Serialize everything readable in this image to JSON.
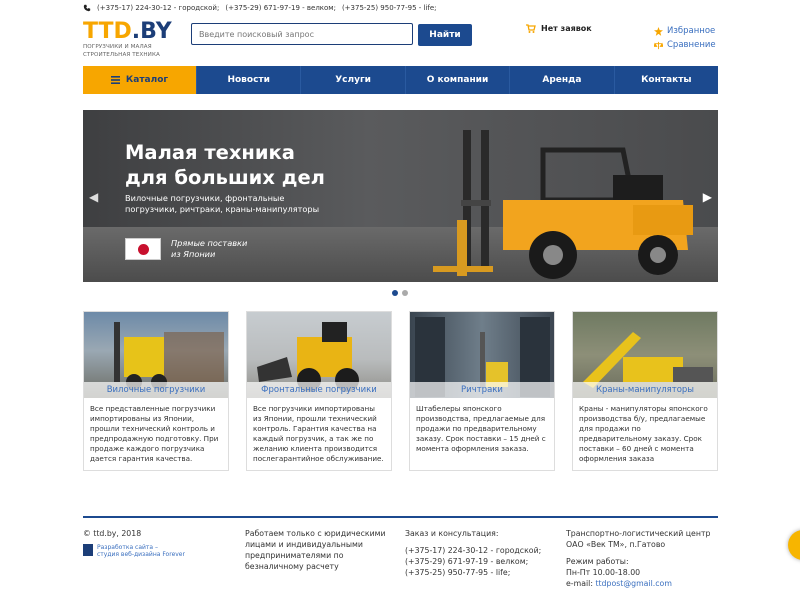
{
  "topbar": {
    "phone1": "(+375-17) 224-30-12 - городской;",
    "phone2": "(+375-29) 671-97-19 - велком;",
    "phone3": "(+375-25) 950-77-95 - life;"
  },
  "logo": {
    "main_a": "TTD",
    "main_b": ".BY",
    "sub1": "Погрузчики и малая",
    "sub2": "строительная техника"
  },
  "search": {
    "placeholder": "Введите поисковый запрос",
    "button": "Найти"
  },
  "cart": {
    "label": "Нет заявок"
  },
  "favs": {
    "favorites": "Избранное",
    "compare": "Сравнение"
  },
  "nav": {
    "catalog": "Каталог",
    "items": [
      "Новости",
      "Услуги",
      "О компании",
      "Аренда",
      "Контакты"
    ]
  },
  "hero": {
    "title1": "Малая техника",
    "title2": "для больших дел",
    "sub1": "Вилочные погрузчики, фронтальные",
    "sub2": "погрузчики, ричтраки, краны-манипуляторы",
    "direct1": "Прямые поставки",
    "direct2": "из Японии"
  },
  "cards": [
    {
      "title": "Вилочные погрузчики",
      "text": "Все представленные погрузчики импортированы из Японии, прошли технический контроль и предпродажную подготовку. При продаже каждого погрузчика дается гарантия качества."
    },
    {
      "title": "Фронтальные погрузчики",
      "text": "Все погрузчики импортированы из Японии, прошли технический контроль. Гарантия качества на каждый погрузчик, а так же по желанию клиента производится послегарантийное обслуживание."
    },
    {
      "title": "Ричтраки",
      "text": "Штабелеры японского производства, предлагаемые для продажи по предварительному заказу. Срок поставки – 15 дней с момента оформления заказа."
    },
    {
      "title": "Краны-манипуляторы",
      "text": "Краны - манипуляторы японского производства б/у, предлагаемые для продажи по предварительному заказу. Срок поставки – 60 дней с момента оформления заказа"
    }
  ],
  "footer": {
    "copyright": "© ttd.by, 2018",
    "dev1": "Разработка сайта –",
    "dev2": "студия веб-дизайна Forever",
    "legal": "Работаем только с юридическими лицами и индивидуальными предпринимателями по безналичному расчету",
    "order_title": "Заказ и консультация:",
    "order_p1": "(+375-17) 224-30-12 - городской;",
    "order_p2": "(+375-29) 671-97-19 - велком;",
    "order_p3": "(+375-25) 950-77-95 - life;",
    "company1": "Транспортно-логистический центр",
    "company2": "ОАО «Век ТМ», п.Гатово",
    "hours_title": "Режим работы:",
    "hours": "Пн-Пт 10.00-18.00",
    "email_label": "e-mail:",
    "email": "ttdpost@gmail.com"
  },
  "colors": {
    "brand_orange": "#f7a600",
    "brand_blue": "#1c4a8f",
    "link": "#3a6fbf"
  }
}
